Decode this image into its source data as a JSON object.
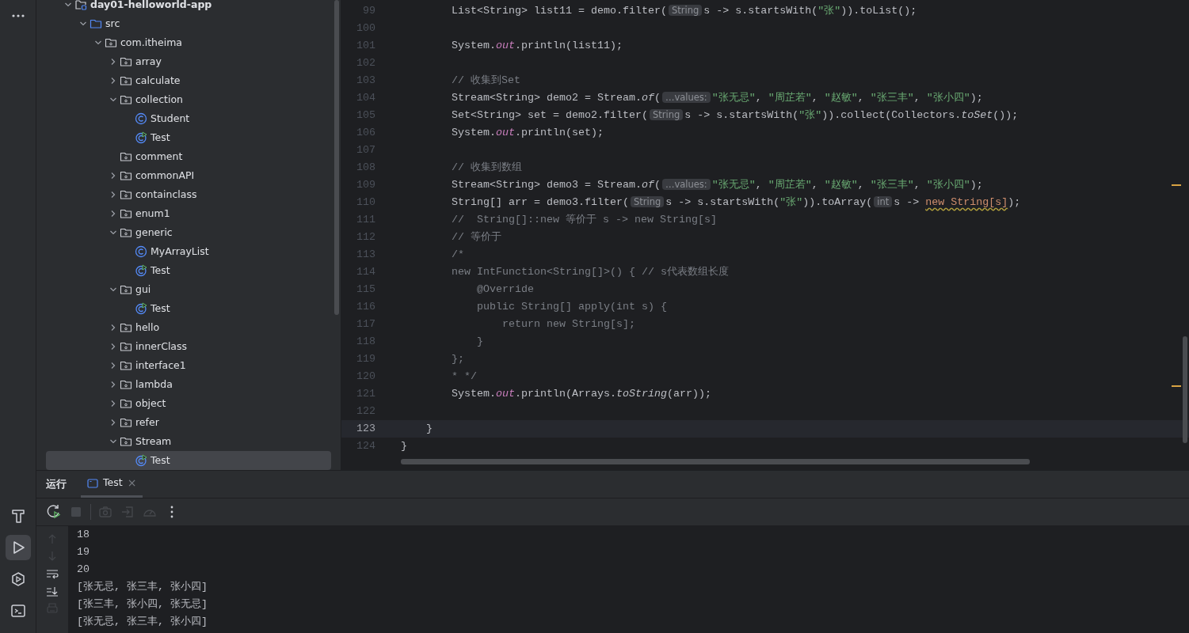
{
  "tool_strip": [
    {
      "kind": "more",
      "selected": false
    },
    {
      "kind": "build",
      "selected": false
    },
    {
      "kind": "run",
      "selected": true
    },
    {
      "kind": "services",
      "selected": false
    },
    {
      "kind": "terminal",
      "selected": false
    }
  ],
  "project_tree": [
    {
      "label": "day01-helloworld-app",
      "kind": "module",
      "expanded": true,
      "selected": false,
      "children": [
        {
          "label": "src",
          "kind": "source-folder",
          "expanded": true,
          "selected": false,
          "children": [
            {
              "label": "com.itheima",
              "kind": "package",
              "expanded": true,
              "selected": false,
              "children": [
                {
                  "label": "array",
                  "kind": "package",
                  "expanded": false,
                  "selected": false
                },
                {
                  "label": "calculate",
                  "kind": "package",
                  "expanded": false,
                  "selected": false
                },
                {
                  "label": "collection",
                  "kind": "package",
                  "expanded": true,
                  "selected": false,
                  "children": [
                    {
                      "label": "Student",
                      "kind": "class",
                      "selected": false
                    },
                    {
                      "label": "Test",
                      "kind": "main-class",
                      "selected": false
                    }
                  ]
                },
                {
                  "label": "comment",
                  "kind": "empty-package",
                  "expanded": false,
                  "selected": false
                },
                {
                  "label": "commonAPI",
                  "kind": "package",
                  "expanded": false,
                  "selected": false
                },
                {
                  "label": "containclass",
                  "kind": "package",
                  "expanded": false,
                  "selected": false
                },
                {
                  "label": "enum1",
                  "kind": "package",
                  "expanded": false,
                  "selected": false
                },
                {
                  "label": "generic",
                  "kind": "package",
                  "expanded": true,
                  "selected": false,
                  "children": [
                    {
                      "label": "MyArrayList",
                      "kind": "class",
                      "selected": false
                    },
                    {
                      "label": "Test",
                      "kind": "main-class",
                      "selected": false
                    }
                  ]
                },
                {
                  "label": "gui",
                  "kind": "package",
                  "expanded": true,
                  "selected": false,
                  "children": [
                    {
                      "label": "Test",
                      "kind": "main-class",
                      "selected": false
                    }
                  ]
                },
                {
                  "label": "hello",
                  "kind": "package",
                  "expanded": false,
                  "selected": false
                },
                {
                  "label": "innerClass",
                  "kind": "package",
                  "expanded": false,
                  "selected": false
                },
                {
                  "label": "interface1",
                  "kind": "package",
                  "expanded": false,
                  "selected": false
                },
                {
                  "label": "lambda",
                  "kind": "package",
                  "expanded": false,
                  "selected": false
                },
                {
                  "label": "object",
                  "kind": "package",
                  "expanded": false,
                  "selected": false
                },
                {
                  "label": "refer",
                  "kind": "package",
                  "expanded": false,
                  "selected": false
                },
                {
                  "label": "Stream",
                  "kind": "package",
                  "expanded": true,
                  "selected": false,
                  "children": [
                    {
                      "label": "Test",
                      "kind": "main-class",
                      "selected": true
                    }
                  ]
                }
              ]
            }
          ]
        }
      ]
    }
  ],
  "editor": {
    "lines": [
      {
        "number": "99",
        "current": false,
        "tokens": [
          {
            "kind": "plain",
            "text": "        List<String> list11 = demo.filter("
          },
          {
            "kind": "hint",
            "text": "String"
          },
          {
            "kind": "plain",
            "text": "s -> s.startsWith("
          },
          {
            "kind": "string",
            "text": "\"张\""
          },
          {
            "kind": "plain",
            "text": ")).toList();"
          }
        ]
      },
      {
        "number": "100",
        "current": false
      },
      {
        "number": "101",
        "current": false,
        "tokens": [
          {
            "kind": "plain",
            "text": "        System."
          },
          {
            "kind": "field",
            "text": "out"
          },
          {
            "kind": "plain",
            "text": ".println(list11);"
          }
        ]
      },
      {
        "number": "102",
        "current": false
      },
      {
        "number": "103",
        "current": false,
        "tokens": [
          {
            "kind": "comment",
            "text": "        // 收集到Set"
          }
        ]
      },
      {
        "number": "104",
        "current": false,
        "tokens": [
          {
            "kind": "plain",
            "text": "        Stream<String> demo2 = Stream."
          },
          {
            "kind": "static",
            "text": "of"
          },
          {
            "kind": "plain",
            "text": "("
          },
          {
            "kind": "hint",
            "text": "…values:"
          },
          {
            "kind": "string",
            "text": "\"张无忌\""
          },
          {
            "kind": "plain",
            "text": ", "
          },
          {
            "kind": "string",
            "text": "\"周芷若\""
          },
          {
            "kind": "plain",
            "text": ", "
          },
          {
            "kind": "string",
            "text": "\"赵敏\""
          },
          {
            "kind": "plain",
            "text": ", "
          },
          {
            "kind": "string",
            "text": "\"张三丰\""
          },
          {
            "kind": "plain",
            "text": ", "
          },
          {
            "kind": "string",
            "text": "\"张小四\""
          },
          {
            "kind": "plain",
            "text": ");"
          }
        ]
      },
      {
        "number": "105",
        "current": false,
        "tokens": [
          {
            "kind": "plain",
            "text": "        Set<String> set = demo2.filter("
          },
          {
            "kind": "hint",
            "text": "String"
          },
          {
            "kind": "plain",
            "text": "s -> s.startsWith("
          },
          {
            "kind": "string",
            "text": "\"张\""
          },
          {
            "kind": "plain",
            "text": ")).collect(Collectors."
          },
          {
            "kind": "static",
            "text": "toSet"
          },
          {
            "kind": "plain",
            "text": "());"
          }
        ]
      },
      {
        "number": "106",
        "current": false,
        "tokens": [
          {
            "kind": "plain",
            "text": "        System."
          },
          {
            "kind": "field",
            "text": "out"
          },
          {
            "kind": "plain",
            "text": ".println(set);"
          }
        ]
      },
      {
        "number": "107",
        "current": false
      },
      {
        "number": "108",
        "current": false,
        "tokens": [
          {
            "kind": "comment",
            "text": "        // 收集到数组"
          }
        ]
      },
      {
        "number": "109",
        "current": false,
        "tokens": [
          {
            "kind": "plain",
            "text": "        Stream<String> demo3 = Stream."
          },
          {
            "kind": "static",
            "text": "of"
          },
          {
            "kind": "plain",
            "text": "("
          },
          {
            "kind": "hint",
            "text": "…values:"
          },
          {
            "kind": "string",
            "text": "\"张无忌\""
          },
          {
            "kind": "plain",
            "text": ", "
          },
          {
            "kind": "string",
            "text": "\"周芷若\""
          },
          {
            "kind": "plain",
            "text": ", "
          },
          {
            "kind": "string",
            "text": "\"赵敏\""
          },
          {
            "kind": "plain",
            "text": ", "
          },
          {
            "kind": "string",
            "text": "\"张三丰\""
          },
          {
            "kind": "plain",
            "text": ", "
          },
          {
            "kind": "string",
            "text": "\"张小四\""
          },
          {
            "kind": "plain",
            "text": ");"
          }
        ]
      },
      {
        "number": "110",
        "current": false,
        "tokens": [
          {
            "kind": "plain",
            "text": "        String[] arr = demo3.filter("
          },
          {
            "kind": "hint",
            "text": "String"
          },
          {
            "kind": "plain",
            "text": "s -> s.startsWith("
          },
          {
            "kind": "string",
            "text": "\"张\""
          },
          {
            "kind": "plain",
            "text": ")).toArray("
          },
          {
            "kind": "hint",
            "text": "int"
          },
          {
            "kind": "plain",
            "text": "s -> "
          },
          {
            "kind": "keyword-warning",
            "text": "new String[s]"
          },
          {
            "kind": "plain",
            "text": ");"
          }
        ]
      },
      {
        "number": "111",
        "current": false,
        "tokens": [
          {
            "kind": "comment",
            "text": "        //  String[]::new 等价于 s -> new String[s]"
          }
        ]
      },
      {
        "number": "112",
        "current": false,
        "tokens": [
          {
            "kind": "comment",
            "text": "        // 等价于"
          }
        ]
      },
      {
        "number": "113",
        "current": false,
        "tokens": [
          {
            "kind": "comment",
            "text": "        /*"
          }
        ]
      },
      {
        "number": "114",
        "current": false,
        "tokens": [
          {
            "kind": "comment",
            "text": "        new IntFunction<String[]>() { // s代表数组长度"
          }
        ]
      },
      {
        "number": "115",
        "current": false,
        "tokens": [
          {
            "kind": "comment",
            "text": "            @Override"
          }
        ]
      },
      {
        "number": "116",
        "current": false,
        "tokens": [
          {
            "kind": "comment",
            "text": "            public String[] apply(int s) {"
          }
        ]
      },
      {
        "number": "117",
        "current": false,
        "tokens": [
          {
            "kind": "comment",
            "text": "                return new String[s];"
          }
        ]
      },
      {
        "number": "118",
        "current": false,
        "tokens": [
          {
            "kind": "comment",
            "text": "            }"
          }
        ]
      },
      {
        "number": "119",
        "current": false,
        "tokens": [
          {
            "kind": "comment",
            "text": "        };"
          }
        ]
      },
      {
        "number": "120",
        "current": false,
        "tokens": [
          {
            "kind": "comment",
            "text": "        * */"
          }
        ]
      },
      {
        "number": "121",
        "current": false,
        "tokens": [
          {
            "kind": "plain",
            "text": "        System."
          },
          {
            "kind": "field",
            "text": "out"
          },
          {
            "kind": "plain",
            "text": ".println(Arrays."
          },
          {
            "kind": "static",
            "text": "toString"
          },
          {
            "kind": "plain",
            "text": "(arr));"
          }
        ]
      },
      {
        "number": "122",
        "current": false
      },
      {
        "number": "123",
        "current": true,
        "tokens": [
          {
            "kind": "plain",
            "text": "    }"
          }
        ]
      },
      {
        "number": "124",
        "current": false,
        "tokens": [
          {
            "kind": "plain",
            "text": "}"
          }
        ]
      }
    ]
  },
  "run_panel": {
    "title": "运行",
    "tabs": [
      {
        "label": "Test",
        "selected": true,
        "closable": true,
        "close": "×"
      }
    ],
    "toolbar": [
      {
        "kind": "rerun",
        "disabled": false
      },
      {
        "kind": "stop",
        "disabled": true
      },
      {
        "kind": "separator"
      },
      {
        "kind": "screenshot",
        "disabled": true
      },
      {
        "kind": "import",
        "disabled": true
      },
      {
        "kind": "profiler",
        "disabled": true
      },
      {
        "kind": "more",
        "disabled": false
      }
    ],
    "gutter": [
      {
        "kind": "up",
        "disabled": true
      },
      {
        "kind": "down",
        "disabled": true
      },
      {
        "kind": "wrap",
        "disabled": false
      },
      {
        "kind": "scroll-end",
        "disabled": false
      },
      {
        "kind": "print",
        "disabled": true
      }
    ],
    "output": [
      "18",
      "19",
      "20",
      "[张无忌, 张三丰, 张小四]",
      "[张三丰, 张小四, 张无忌]",
      "[张无忌, 张三丰, 张小四]"
    ]
  }
}
